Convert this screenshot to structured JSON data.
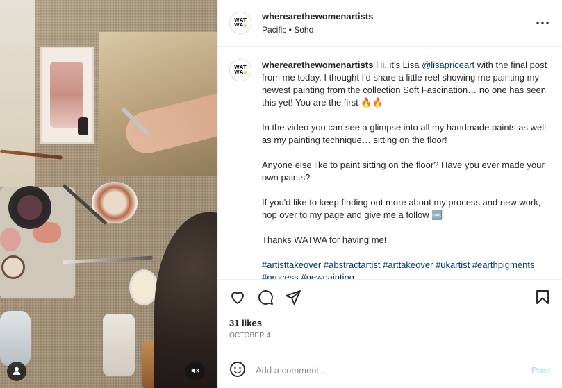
{
  "post": {
    "username": "wherearethewomenartists",
    "location": "Pacific • Soho",
    "avatar_text_line1": "WAT",
    "avatar_text_line2": "WA",
    "more_glyph": "•••"
  },
  "caption": {
    "username": "wherearethewomenartists",
    "intro_before_mention": " Hi, it's Lisa ",
    "mention": "@lisapriceart",
    "intro_after_mention": " with the final post from me today. I thought I'd share a little reel showing me painting my newest painting from the collection Soft Fascination… no one has seen this yet! You are the first 🔥🔥",
    "para2": "In the video you can see a glimpse into all my handmade paints as well as my painting technique… sitting on the floor!",
    "para3": "Anyone else like to paint sitting on the floor? Have you ever made your own paints?",
    "para4": "If you'd like to keep finding out more about my process and new work, hop over to my page and give me a follow 🆒",
    "para5": "Thanks WATWA for having me!",
    "hashtags": [
      "#artisttakeover",
      "#abstractartist",
      "#arttakeover",
      "#ukartist",
      "#earthpigments",
      "#process",
      "#newpainting"
    ]
  },
  "engagement": {
    "likes": "31 likes",
    "date": "OCTOBER 4"
  },
  "comment": {
    "placeholder": "Add a comment...",
    "post_label": "Post"
  },
  "icons": {
    "like": "heart-icon",
    "comment": "comment-icon",
    "share": "share-icon",
    "save": "bookmark-icon",
    "emoji": "emoji-icon",
    "user_tag": "user-tag-icon",
    "mute": "muted-speaker-icon"
  },
  "colors": {
    "link": "#00376b",
    "muted_text": "#737373",
    "post_button_disabled": "#b2dffc",
    "avatar_dot": "#c6e84b"
  }
}
